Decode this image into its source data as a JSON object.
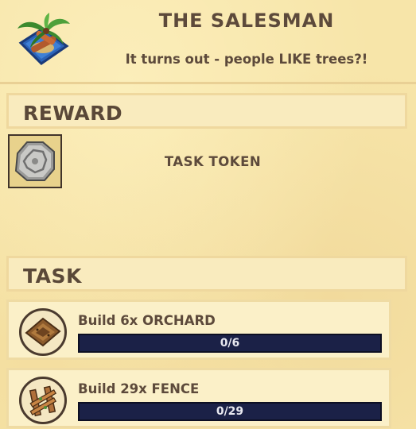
{
  "quest": {
    "title": "THE SALESMAN",
    "subtitle": "It turns out - people LIKE trees?!",
    "icon": "palm-tree-island-icon"
  },
  "reward": {
    "heading": "REWARD",
    "item_label": "TASK TOKEN",
    "item_icon": "task-token-icon"
  },
  "task": {
    "heading": "TASK",
    "items": [
      {
        "label": "Build 6x ORCHARD",
        "progress_text": "0/6",
        "current": 0,
        "target": 6,
        "icon": "orchard-icon"
      },
      {
        "label": "Build 29x FENCE",
        "progress_text": "0/29",
        "current": 0,
        "target": 29,
        "icon": "fence-icon"
      }
    ]
  },
  "colors": {
    "parchment": "#f7e5a9",
    "text": "#5d4a3b",
    "progress_bar": "#1b2147"
  }
}
